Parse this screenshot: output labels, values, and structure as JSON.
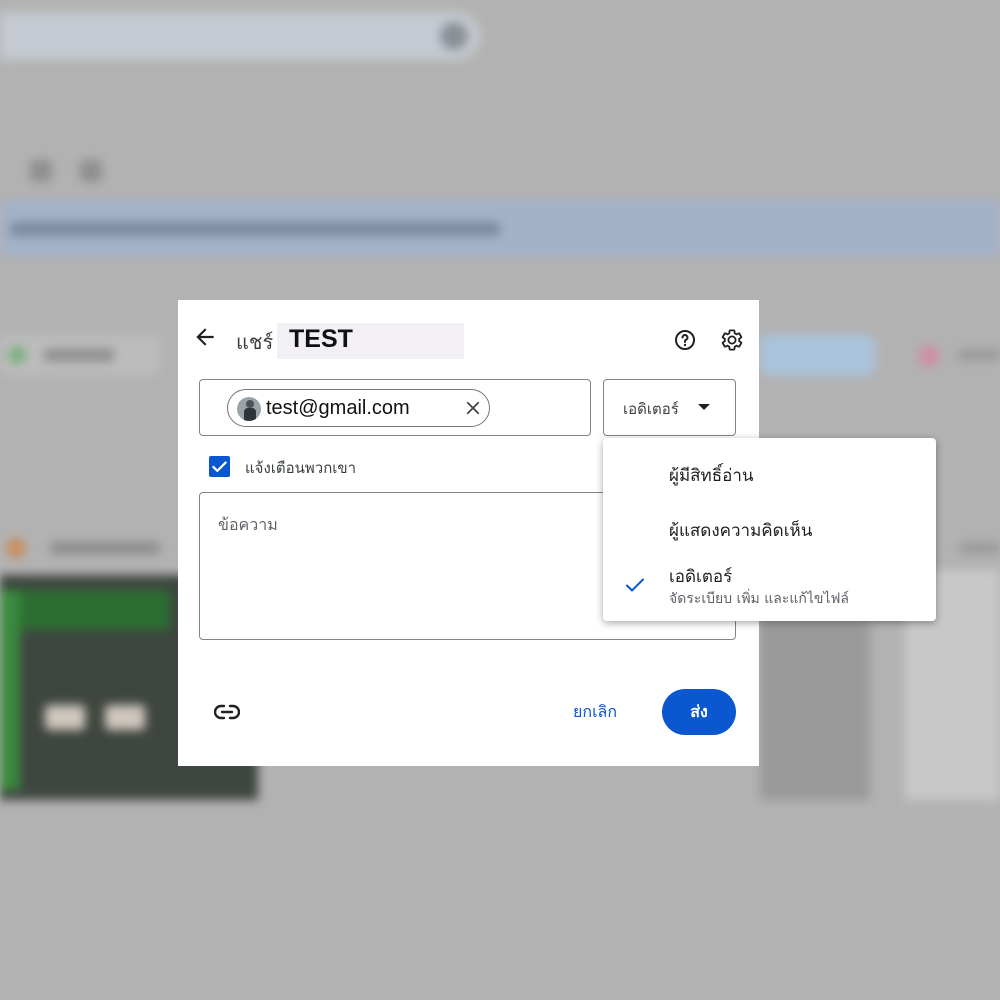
{
  "dialog": {
    "title_prefix": "แชร์",
    "title_name": "TEST"
  },
  "recipients": [
    {
      "email": "test@gmail.com"
    }
  ],
  "role_select": {
    "selected": "เอดิเตอร์"
  },
  "notify": {
    "label": "แจ้งเตือนพวกเขา",
    "checked": true
  },
  "message": {
    "placeholder": "ข้อความ"
  },
  "footer": {
    "cancel_label": "ยกเลิก",
    "send_label": "ส่ง"
  },
  "role_menu": {
    "items": [
      {
        "label": "ผู้มีสิทธิ์อ่าน",
        "description": "",
        "selected": false
      },
      {
        "label": "ผู้แสดงความคิดเห็น",
        "description": "",
        "selected": false
      },
      {
        "label": "เอดิเตอร์",
        "description": "จัดระเบียบ เพิ่ม และแก้ไขไฟล์",
        "selected": true
      }
    ]
  },
  "colors": {
    "accent": "#0b57d0",
    "overlay": "#b3b3b3",
    "surface": "#ffffff"
  },
  "icons": {
    "back": "arrow-back-icon",
    "help": "help-icon",
    "settings": "gear-icon",
    "remove": "close-icon",
    "dropdown": "caret-down-icon",
    "check": "check-icon",
    "link": "link-icon"
  }
}
